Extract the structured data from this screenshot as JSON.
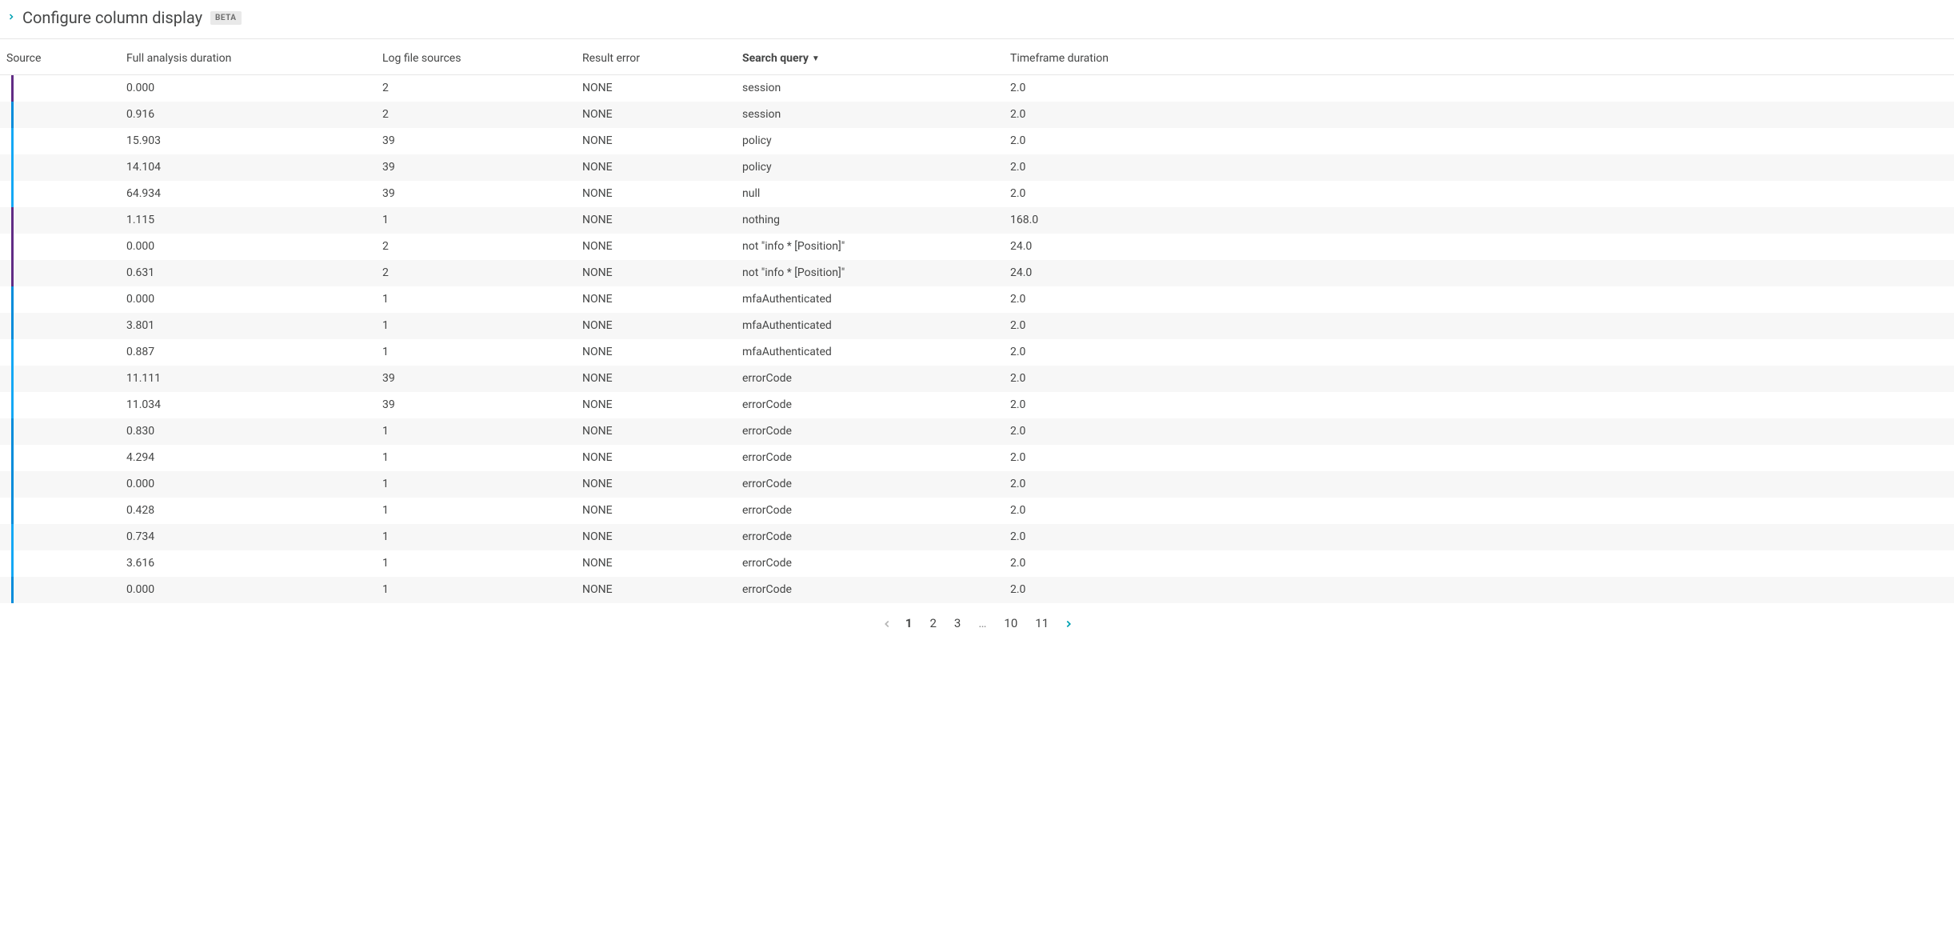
{
  "header": {
    "title": "Configure column display",
    "badge": "BETA"
  },
  "columns": [
    {
      "key": "source",
      "label": "Source",
      "sorted": false
    },
    {
      "key": "duration",
      "label": "Full analysis duration",
      "sorted": false
    },
    {
      "key": "logfiles",
      "label": "Log file sources",
      "sorted": false
    },
    {
      "key": "error",
      "label": "Result error",
      "sorted": false
    },
    {
      "key": "query",
      "label": "Search query",
      "sorted": true,
      "sort_dir": "desc"
    },
    {
      "key": "timeframe",
      "label": "Timeframe duration",
      "sorted": false
    }
  ],
  "rows": [
    {
      "source_color": "purple",
      "duration": "0.000",
      "logfiles": "2",
      "error": "NONE",
      "query": "session",
      "timeframe": "2.0"
    },
    {
      "source_color": "blue",
      "duration": "0.916",
      "logfiles": "2",
      "error": "NONE",
      "query": "session",
      "timeframe": "2.0"
    },
    {
      "source_color": "cyan",
      "duration": "15.903",
      "logfiles": "39",
      "error": "NONE",
      "query": "policy",
      "timeframe": "2.0"
    },
    {
      "source_color": "cyan",
      "duration": "14.104",
      "logfiles": "39",
      "error": "NONE",
      "query": "policy",
      "timeframe": "2.0"
    },
    {
      "source_color": "cyan",
      "duration": "64.934",
      "logfiles": "39",
      "error": "NONE",
      "query": "null",
      "timeframe": "2.0"
    },
    {
      "source_color": "purple",
      "duration": "1.115",
      "logfiles": "1",
      "error": "NONE",
      "query": "nothing",
      "timeframe": "168.0"
    },
    {
      "source_color": "purple",
      "duration": "0.000",
      "logfiles": "2",
      "error": "NONE",
      "query": "not \"info * [Position]\"",
      "timeframe": "24.0"
    },
    {
      "source_color": "purple",
      "duration": "0.631",
      "logfiles": "2",
      "error": "NONE",
      "query": "not \"info * [Position]\"",
      "timeframe": "24.0"
    },
    {
      "source_color": "blue",
      "duration": "0.000",
      "logfiles": "1",
      "error": "NONE",
      "query": "mfaAuthenticated",
      "timeframe": "2.0"
    },
    {
      "source_color": "blue",
      "duration": "3.801",
      "logfiles": "1",
      "error": "NONE",
      "query": "mfaAuthenticated",
      "timeframe": "2.0"
    },
    {
      "source_color": "cyan",
      "duration": "0.887",
      "logfiles": "1",
      "error": "NONE",
      "query": "mfaAuthenticated",
      "timeframe": "2.0"
    },
    {
      "source_color": "cyan",
      "duration": "11.111",
      "logfiles": "39",
      "error": "NONE",
      "query": "errorCode",
      "timeframe": "2.0"
    },
    {
      "source_color": "cyan",
      "duration": "11.034",
      "logfiles": "39",
      "error": "NONE",
      "query": "errorCode",
      "timeframe": "2.0"
    },
    {
      "source_color": "blue",
      "duration": "0.830",
      "logfiles": "1",
      "error": "NONE",
      "query": "errorCode",
      "timeframe": "2.0"
    },
    {
      "source_color": "blue",
      "duration": "4.294",
      "logfiles": "1",
      "error": "NONE",
      "query": "errorCode",
      "timeframe": "2.0"
    },
    {
      "source_color": "blue",
      "duration": "0.000",
      "logfiles": "1",
      "error": "NONE",
      "query": "errorCode",
      "timeframe": "2.0"
    },
    {
      "source_color": "blue",
      "duration": "0.428",
      "logfiles": "1",
      "error": "NONE",
      "query": "errorCode",
      "timeframe": "2.0"
    },
    {
      "source_color": "cyan",
      "duration": "0.734",
      "logfiles": "1",
      "error": "NONE",
      "query": "errorCode",
      "timeframe": "2.0"
    },
    {
      "source_color": "cyan",
      "duration": "3.616",
      "logfiles": "1",
      "error": "NONE",
      "query": "errorCode",
      "timeframe": "2.0"
    },
    {
      "source_color": "blue",
      "duration": "0.000",
      "logfiles": "1",
      "error": "NONE",
      "query": "errorCode",
      "timeframe": "2.0"
    }
  ],
  "pagination": {
    "prev_enabled": false,
    "next_enabled": true,
    "pages_left": [
      "1",
      "2",
      "3"
    ],
    "pages_right": [
      "10",
      "11"
    ],
    "current": "1"
  }
}
